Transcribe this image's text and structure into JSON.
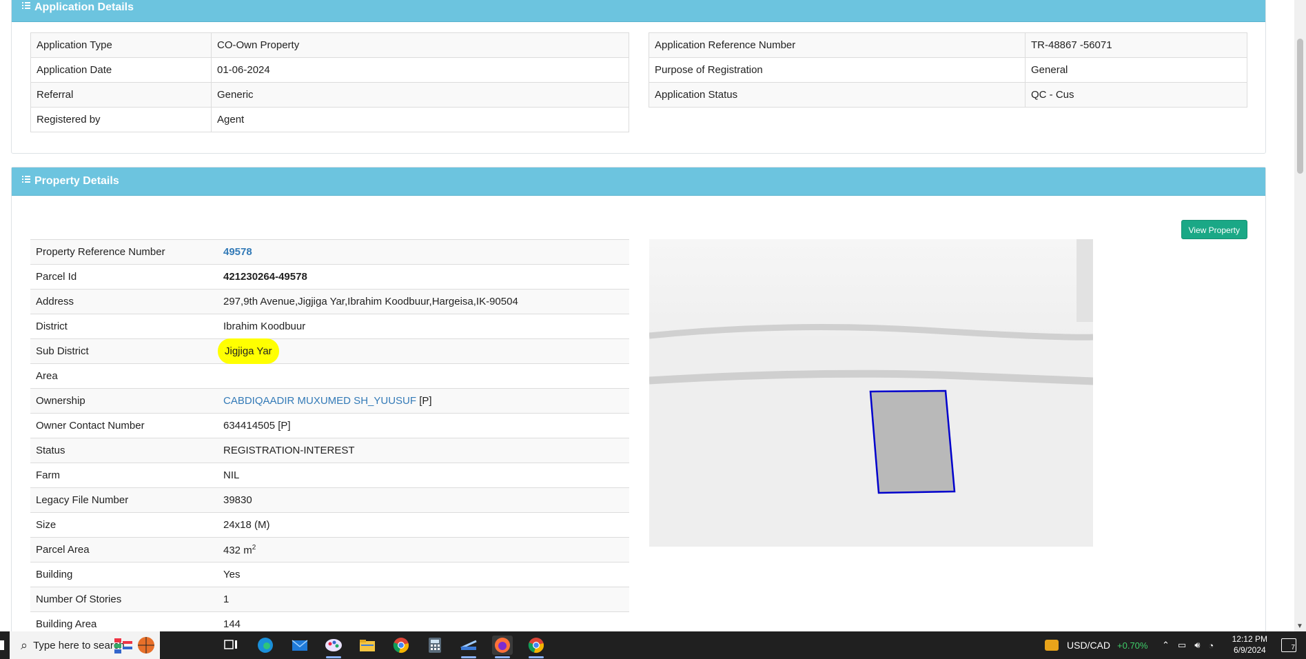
{
  "application_details": {
    "title": "Application Details",
    "left_rows": [
      {
        "label": "Application Type",
        "value": "CO-Own Property"
      },
      {
        "label": "Application Date",
        "value": "01-06-2024"
      },
      {
        "label": "Referral",
        "value": "Generic"
      },
      {
        "label": "Registered by",
        "value": "Agent"
      }
    ],
    "right_rows": [
      {
        "label": "Application Reference Number",
        "value": "TR-48867 -56071"
      },
      {
        "label": "Purpose of Registration",
        "value": "General"
      },
      {
        "label": "Application Status",
        "value": "QC - Cus"
      }
    ]
  },
  "property_details": {
    "title": "Property Details",
    "view_button": "View Property",
    "rows": [
      {
        "label": "Property Reference Number",
        "value": "49578"
      },
      {
        "label": "Parcel Id",
        "value": "421230264-49578"
      },
      {
        "label": "Address",
        "value": "297,9th Avenue,Jigjiga Yar,Ibrahim Koodbuur,Hargeisa,IK-90504"
      },
      {
        "label": "District",
        "value": "Ibrahim Koodbuur"
      },
      {
        "label": "Sub District",
        "value": "Jigjiga Yar"
      },
      {
        "label": "Area",
        "value": ""
      },
      {
        "label": "Ownership",
        "value": "CABDIQAADIR MUXUMED SH_YUUSUF",
        "suffix": "[P]"
      },
      {
        "label": "Owner Contact Number",
        "value": "634414505 [P]"
      },
      {
        "label": "Status",
        "value": "REGISTRATION-INTEREST"
      },
      {
        "label": "Farm",
        "value": "NIL"
      },
      {
        "label": "Legacy File Number",
        "value": "39830"
      },
      {
        "label": "Size",
        "value": "24x18 (M)"
      },
      {
        "label": "Parcel Area",
        "value": "432 m",
        "sup": "2"
      },
      {
        "label": "Building",
        "value": "Yes"
      },
      {
        "label": "Number Of Stories",
        "value": "1"
      },
      {
        "label": "Building Area",
        "value": "144"
      }
    ]
  },
  "taskbar": {
    "search_placeholder": "Type here to search",
    "ticker_label": "USD/CAD",
    "ticker_change": "+0.70%",
    "time": "12:12 PM",
    "date": "6/9/2024",
    "notification_count": "7"
  },
  "colors": {
    "panel_header": "#6cc4df",
    "link": "#337ab7",
    "button": "#1aa886",
    "highlight": "#ffff00",
    "parcel_outline": "#0000cc"
  }
}
